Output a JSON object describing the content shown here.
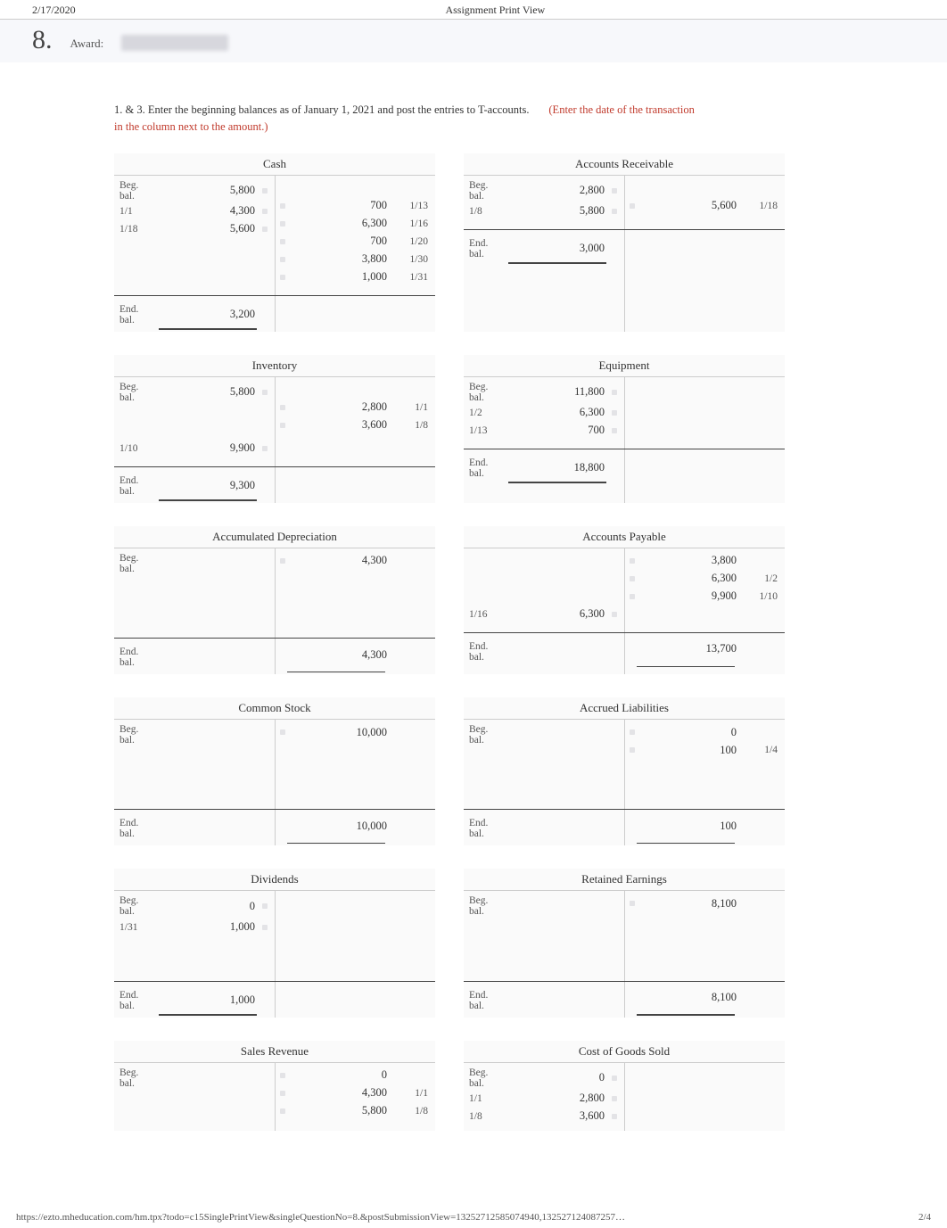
{
  "header": {
    "date": "2/17/2020",
    "title": "Assignment Print View"
  },
  "question": {
    "number": "8.",
    "award_label": "Award:"
  },
  "instructions": {
    "main": "1. & 3.  Enter the beginning balances as of January 1, 2021 and post the entries to T-accounts.",
    "note_prefix": "(Enter the date of the transaction ",
    "note_rest": "in the column next to the amount.)"
  },
  "accounts": {
    "cash": {
      "title": "Cash",
      "debit_beg_label": "Beg.\nbal.",
      "debit_rows": [
        {
          "label": "Beg.\nbal.",
          "amount": "5,800"
        },
        {
          "label": "1/1",
          "amount": "4,300"
        },
        {
          "label": "1/18",
          "amount": "5,600"
        }
      ],
      "credit_rows": [
        {
          "spacer": true
        },
        {
          "amount": "700",
          "date": "1/13"
        },
        {
          "amount": "6,300",
          "date": "1/16"
        },
        {
          "amount": "700",
          "date": "1/20"
        },
        {
          "amount": "3,800",
          "date": "1/30"
        },
        {
          "amount": "1,000",
          "date": "1/31"
        }
      ],
      "end_label": "End.\nbal.",
      "end_debit": "3,200"
    },
    "ar": {
      "title": "Accounts Receivable",
      "debit_rows": [
        {
          "label": "Beg.\nbal.",
          "amount": "2,800"
        },
        {
          "label": "1/8",
          "amount": "5,800"
        }
      ],
      "credit_rows": [
        {
          "spacer": true
        },
        {
          "amount": "5,600",
          "date": "1/18"
        }
      ],
      "end_label": "End.\nbal.",
      "end_debit": "3,000"
    },
    "inventory": {
      "title": "Inventory",
      "debit_rows": [
        {
          "label": "Beg.\nbal.",
          "amount": "5,800"
        },
        {
          "spacer": true
        },
        {
          "spacer": true
        },
        {
          "label": "1/10",
          "amount": "9,900"
        }
      ],
      "credit_rows": [
        {
          "spacer": true
        },
        {
          "amount": "2,800",
          "date": "1/1"
        },
        {
          "amount": "3,600",
          "date": "1/8"
        }
      ],
      "end_label": "End.\nbal.",
      "end_debit": "9,300"
    },
    "equipment": {
      "title": "Equipment",
      "debit_rows": [
        {
          "label": "Beg.\nbal.",
          "amount": "11,800"
        },
        {
          "label": "1/2",
          "amount": "6,300"
        },
        {
          "label": "1/13",
          "amount": "700"
        }
      ],
      "credit_rows": [],
      "end_label": "End.\nbal.",
      "end_debit": "18,800"
    },
    "accdep": {
      "title": "Accumulated Depreciation",
      "debit_rows": [],
      "credit_rows": [
        {
          "amount": "4,300",
          "beg": true
        },
        {
          "spacer": true
        },
        {
          "spacer": true
        },
        {
          "spacer": true
        }
      ],
      "end_label": "End.\nbal.",
      "end_credit": "4,300",
      "beg_label": "Beg.\nbal."
    },
    "ap": {
      "title": "Accounts Payable",
      "debit_rows": [
        {
          "spacer": true
        },
        {
          "spacer": true
        },
        {
          "spacer": true
        },
        {
          "label": "1/16",
          "amount": "6,300"
        }
      ],
      "credit_rows": [
        {
          "amount": "3,800",
          "beg": true
        },
        {
          "amount": "6,300",
          "date": "1/2"
        },
        {
          "amount": "9,900",
          "date": "1/10"
        }
      ],
      "end_label": "End.\nbal.",
      "end_credit": "13,700",
      "beg_label": "Beg.\nbal."
    },
    "common": {
      "title": "Common Stock",
      "credit_rows": [
        {
          "amount": "10,000",
          "beg": true
        },
        {
          "spacer": true
        },
        {
          "spacer": true
        },
        {
          "spacer": true
        }
      ],
      "end_label": "End.\nbal.",
      "end_credit": "10,000",
      "beg_label": "Beg.\nbal."
    },
    "accrued": {
      "title": "Accrued Liabilities",
      "credit_rows": [
        {
          "amount": "0",
          "beg": true
        },
        {
          "amount": "100",
          "date": "1/4"
        },
        {
          "spacer": true
        },
        {
          "spacer": true
        }
      ],
      "end_label": "End.\nbal.",
      "end_credit": "100",
      "beg_label": "Beg.\nbal."
    },
    "dividends": {
      "title": "Dividends",
      "debit_rows": [
        {
          "label": "Beg.\nbal.",
          "amount": "0"
        },
        {
          "label": "1/31",
          "amount": "1,000"
        },
        {
          "spacer": true
        },
        {
          "spacer": true
        }
      ],
      "credit_rows": [],
      "end_label": "End.\nbal.",
      "end_debit": "1,000"
    },
    "retained": {
      "title": "Retained Earnings",
      "credit_rows": [
        {
          "amount": "8,100",
          "beg": true
        },
        {
          "spacer": true
        },
        {
          "spacer": true
        },
        {
          "spacer": true
        }
      ],
      "end_label": "End.\nbal.",
      "end_credit": "8,100",
      "beg_label": "Beg.\nbal."
    },
    "sales": {
      "title": "Sales Revenue",
      "credit_rows": [
        {
          "amount": "0",
          "beg": true
        },
        {
          "amount": "4,300",
          "date": "1/1"
        },
        {
          "amount": "5,800",
          "date": "1/8"
        }
      ],
      "beg_label": "Beg.\nbal."
    },
    "cogs": {
      "title": "Cost of Goods Sold",
      "debit_rows": [
        {
          "label": "Beg.\nbal.",
          "amount": "0"
        },
        {
          "label": "1/1",
          "amount": "2,800"
        },
        {
          "label": "1/8",
          "amount": "3,600"
        }
      ],
      "credit_rows": []
    }
  },
  "footer": {
    "url": "https://ezto.mheducation.com/hm.tpx?todo=c15SinglePrintView&singleQuestionNo=8.&postSubmissionView=13252712585074940,132527124087257…",
    "pagenum": "2/4"
  }
}
